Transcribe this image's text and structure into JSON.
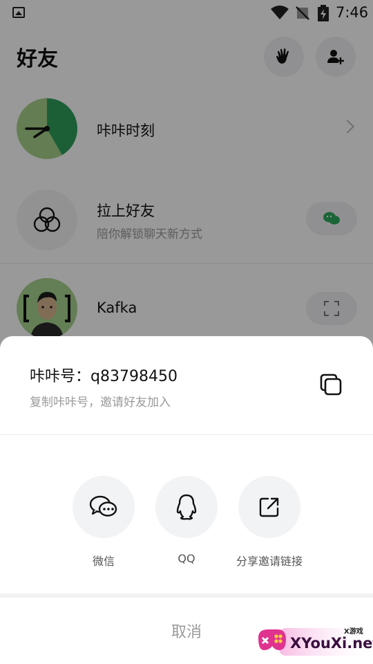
{
  "status_bar": {
    "time": "7:46"
  },
  "header": {
    "title": "好友"
  },
  "rows": {
    "moments": {
      "title": "咔咔时刻"
    },
    "invite": {
      "title": "拉上好友",
      "subtitle": "陪你解锁聊天新方式"
    },
    "contact": {
      "name": "Kafka"
    }
  },
  "sheet": {
    "id_label": "咔咔号：q83798450",
    "id_hint": "复制咔咔号，邀请好友加入",
    "share_options": [
      {
        "label": "微信",
        "icon": "wechat-icon"
      },
      {
        "label": "QQ",
        "icon": "qq-icon"
      },
      {
        "label": "分享邀请链接",
        "icon": "share-link-icon"
      }
    ],
    "cancel_label": "取消"
  },
  "watermark": {
    "text": "XYouXi.net",
    "small": "X游戏"
  },
  "colors": {
    "accent_green": "#2fa85e",
    "overlay": "rgba(0,0,0,0.40)",
    "sheet_button_bg": "#f2f3f5"
  }
}
